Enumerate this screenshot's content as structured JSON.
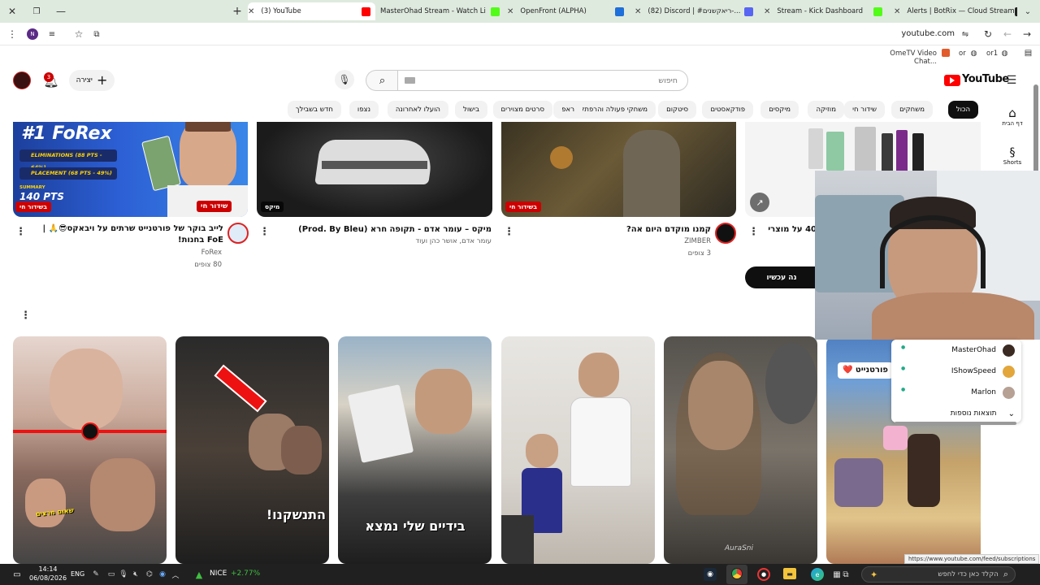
{
  "browser": {
    "tabs": [
      {
        "label": "(3) YouTube",
        "favicon_color": "#ff0000",
        "active": true
      },
      {
        "label": "MasterOhad Stream - Watch Li",
        "favicon_color": "#53fc18"
      },
      {
        "label": "OpenFront (ALPHA)",
        "favicon_color": "#1e6fd9"
      },
      {
        "label": "(82) Discord | #ריאקשנים-...",
        "favicon_color": "#5865f2"
      },
      {
        "label": "Stream - Kick Dashboard",
        "favicon_color": "#53fc18"
      },
      {
        "label": "Alerts | BotRix — Cloud Stream",
        "favicon_color": "#222222"
      }
    ],
    "url": "youtube.com",
    "profile_initial": "N",
    "bookmarks": [
      {
        "label": "OmeTV Video Chat..."
      },
      {
        "label": "or"
      },
      {
        "label": "or1"
      }
    ]
  },
  "youtube": {
    "logo_text": "YouTube",
    "search_placeholder": "חיפוש",
    "create_label": "יצירה",
    "notif_count": "3",
    "chips": [
      "הכול",
      "משחקים",
      "שידור חי",
      "מוזיקה",
      "מיקסים",
      "פודקאסטים",
      "סיטקום",
      "משחקי פעולה והרפתקאות",
      "ראפ",
      "סרטים מצוירים",
      "בישול",
      "הועלו לאחרונה",
      "נצפו",
      "חדש בשבילך"
    ],
    "sidebar": [
      {
        "label": "דף הבית"
      },
      {
        "label": "Shorts"
      }
    ],
    "videos": [
      {
        "title": "לייב בוקר של פורטנייט שרתים על ויבאקס😎🙏 | FoE בחנות!",
        "channel": "FoRex",
        "meta": "80 צופים",
        "badge": "שידור חי",
        "badge_small": "בשידור חי",
        "thumb_text": "#1 FoRex",
        "thumb_lines": [
          "ELIMINATIONS (88 PTS - 64%)",
          "PLACEMENT (68 PTS - 49%)",
          "SUMMARY",
          "140 PTS"
        ]
      },
      {
        "title": "מיקס – עומר אדם - תקופה חרא (Prod. By Bleu)",
        "channel": "עומר אדם, אושר כהן ועוד",
        "meta": "",
        "badge": "מיקס"
      },
      {
        "title": "קמנו מוקדם היום אה?",
        "channel": "ZIMBER",
        "meta": "3 צופים",
        "badge": "בשידור חי"
      },
      {
        "title": "40 על מוצרי",
        "channel": "",
        "meta": "",
        "badge": ""
      }
    ],
    "watch_now_label": "נה עכשיו",
    "shorts": [
      {
        "caption": "שאום מרצים"
      },
      {
        "caption": "התנשקנו!"
      },
      {
        "caption": "בידיים שלי נמצא"
      },
      {
        "caption": ""
      },
      {
        "caption": "AuraSni"
      },
      {
        "caption": "פורטנייט ❤️"
      }
    ]
  },
  "overlay": {
    "chat_rows": [
      {
        "name": "MasterOhad"
      },
      {
        "name": "IShowSpeed"
      },
      {
        "name": "Marlon"
      }
    ],
    "more_results": "תוצאות נוספות",
    "status_url": "https://www.youtube.com/feed/subscriptions"
  },
  "taskbar": {
    "time": "14:14",
    "date": "06/08/2026",
    "lang": "ENG",
    "stock_name": "NICE",
    "stock_change": "+2.77%",
    "search_placeholder": "הקלד כאן כדי לחפש"
  }
}
